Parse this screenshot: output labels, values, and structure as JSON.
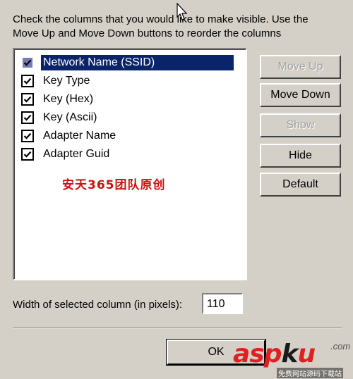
{
  "instructions": {
    "line1": "Check the columns that you would like to make visible. Use the",
    "line2": "Move Up and Move Down buttons to reorder the columns"
  },
  "columns": [
    {
      "label": "Network Name (SSID)",
      "checked": true,
      "selected": true
    },
    {
      "label": "Key Type",
      "checked": true,
      "selected": false
    },
    {
      "label": "Key (Hex)",
      "checked": true,
      "selected": false
    },
    {
      "label": "Key (Ascii)",
      "checked": true,
      "selected": false
    },
    {
      "label": "Adapter Name",
      "checked": true,
      "selected": false
    },
    {
      "label": "Adapter Guid",
      "checked": true,
      "selected": false
    }
  ],
  "buttons": {
    "move_up": "Move Up",
    "move_down": "Move Down",
    "show": "Show",
    "hide": "Hide",
    "default": "Default"
  },
  "width_label": "Width of selected column (in pixels):",
  "width_value": "110",
  "ok_label": "OK",
  "watermark_text": "安天365团队原创",
  "logo": {
    "part1": "asp",
    "part2": "k",
    "part3": "u",
    "suffix": ".com",
    "subtitle": "免费网站源码下载站"
  },
  "colors": {
    "window_bg": "#d4d0c8",
    "selection": "#0a246a",
    "watermark_red": "#cc1111"
  }
}
